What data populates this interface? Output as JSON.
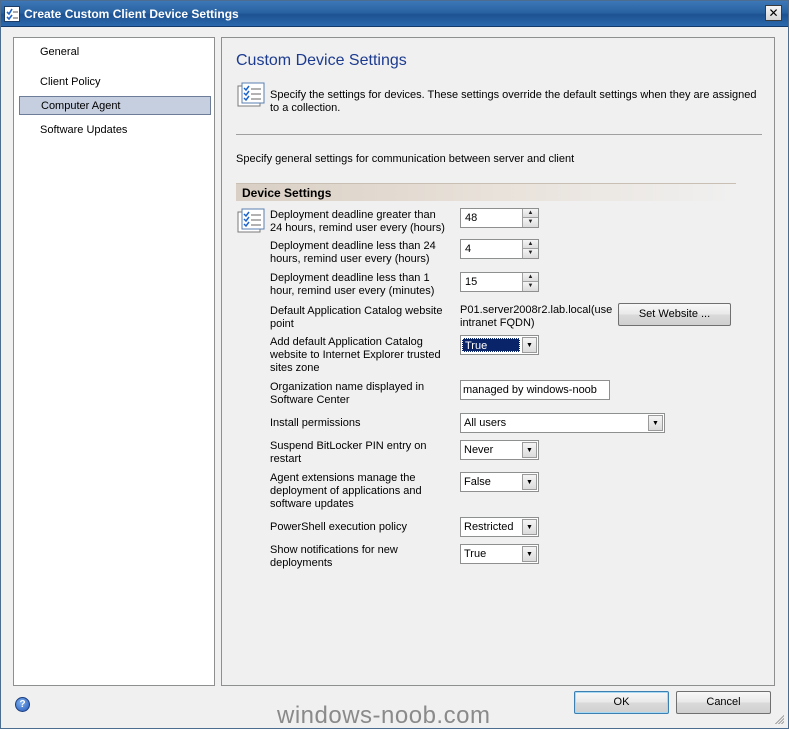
{
  "window": {
    "title": "Create Custom Client Device Settings",
    "close_glyph": "✕"
  },
  "nav": {
    "items": [
      {
        "label": "General",
        "selected": false
      },
      {
        "label": "Client Policy",
        "selected": false
      },
      {
        "label": "Computer Agent",
        "selected": true
      },
      {
        "label": "Software Updates",
        "selected": false
      }
    ]
  },
  "content": {
    "title": "Custom Device Settings",
    "description": "Specify the settings for devices. These settings override the default settings when they are assigned to a collection.",
    "general_description": "Specify general settings for communication between server and client",
    "section_label": "Device Settings",
    "settings": {
      "deadline_24h": {
        "label": "Deployment deadline greater than 24 hours, remind user every (hours)",
        "value": "48"
      },
      "deadline_lt24h": {
        "label": "Deployment deadline less than 24 hours, remind user every (hours)",
        "value": "4"
      },
      "deadline_lt1h": {
        "label": "Deployment deadline less than 1 hour, remind user every (minutes)",
        "value": "15"
      },
      "app_catalog_point": {
        "label": "Default Application Catalog website point",
        "value": "P01.server2008r2.lab.local(use intranet FQDN)",
        "button": "Set Website ..."
      },
      "trusted_sites": {
        "label": "Add default Application Catalog website to Internet Explorer trusted sites zone",
        "value": "True"
      },
      "org_name": {
        "label": "Organization name displayed in Software Center",
        "value": "managed by windows-noob"
      },
      "install_permissions": {
        "label": "Install permissions",
        "value": "All users"
      },
      "bitlocker": {
        "label": "Suspend BitLocker PIN entry on restart",
        "value": "Never"
      },
      "agent_extensions": {
        "label": "Agent extensions manage the deployment of applications and software updates",
        "value": "False"
      },
      "powershell": {
        "label": "PowerShell execution policy",
        "value": "Restricted"
      },
      "notifications": {
        "label": "Show notifications for new deployments",
        "value": "True"
      }
    }
  },
  "footer": {
    "ok_label": "OK",
    "cancel_label": "Cancel",
    "help_glyph": "?",
    "watermark": "windows-noob.com"
  },
  "icons": {
    "window": "settings-checklist-icon",
    "header": "settings-checklist-icon",
    "help": "help-icon"
  },
  "colors": {
    "title_text": "#1c3b8f",
    "titlebar": "#2a63a2",
    "selection": "#0a246a"
  }
}
